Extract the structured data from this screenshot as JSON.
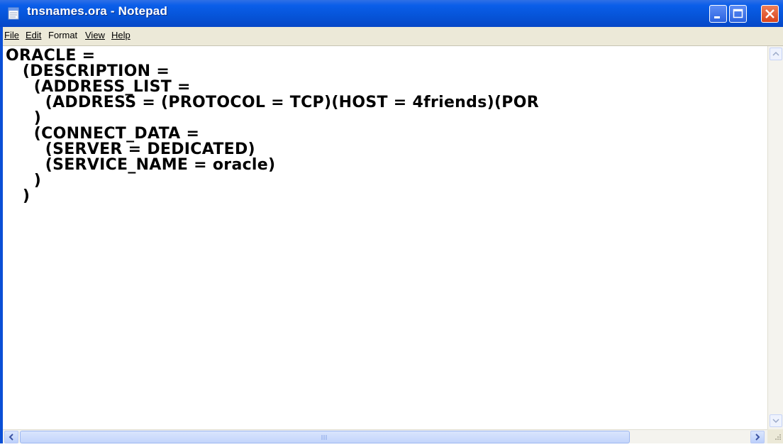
{
  "window": {
    "title": "tnsnames.ora - Notepad",
    "icon": "notepad-icon"
  },
  "controls": {
    "minimize_icon": "minimize-icon",
    "maximize_icon": "maximize-icon",
    "close_icon": "close-icon"
  },
  "menu": {
    "items": [
      {
        "label": "File",
        "mnemonic": "F"
      },
      {
        "label": "Edit",
        "mnemonic": "E"
      },
      {
        "label": "Format",
        "mnemonic": "o"
      },
      {
        "label": "View",
        "mnemonic": "V"
      },
      {
        "label": "Help",
        "mnemonic": "H"
      }
    ]
  },
  "document": {
    "lines": [
      "ORACLE =",
      "   (DESCRIPTION =",
      "     (ADDRESS_LIST =",
      "       (ADDRESS = (PROTOCOL = TCP)(HOST = 4friends)(POR",
      "     )",
      "     (CONNECT_DATA =",
      "       (SERVER = DEDICATED)",
      "       (SERVICE_NAME = oracle)",
      "     )",
      "   )"
    ]
  },
  "colors": {
    "titlebar": "#0654d8",
    "menubar": "#ece9d8",
    "close_button": "#d9431c"
  }
}
